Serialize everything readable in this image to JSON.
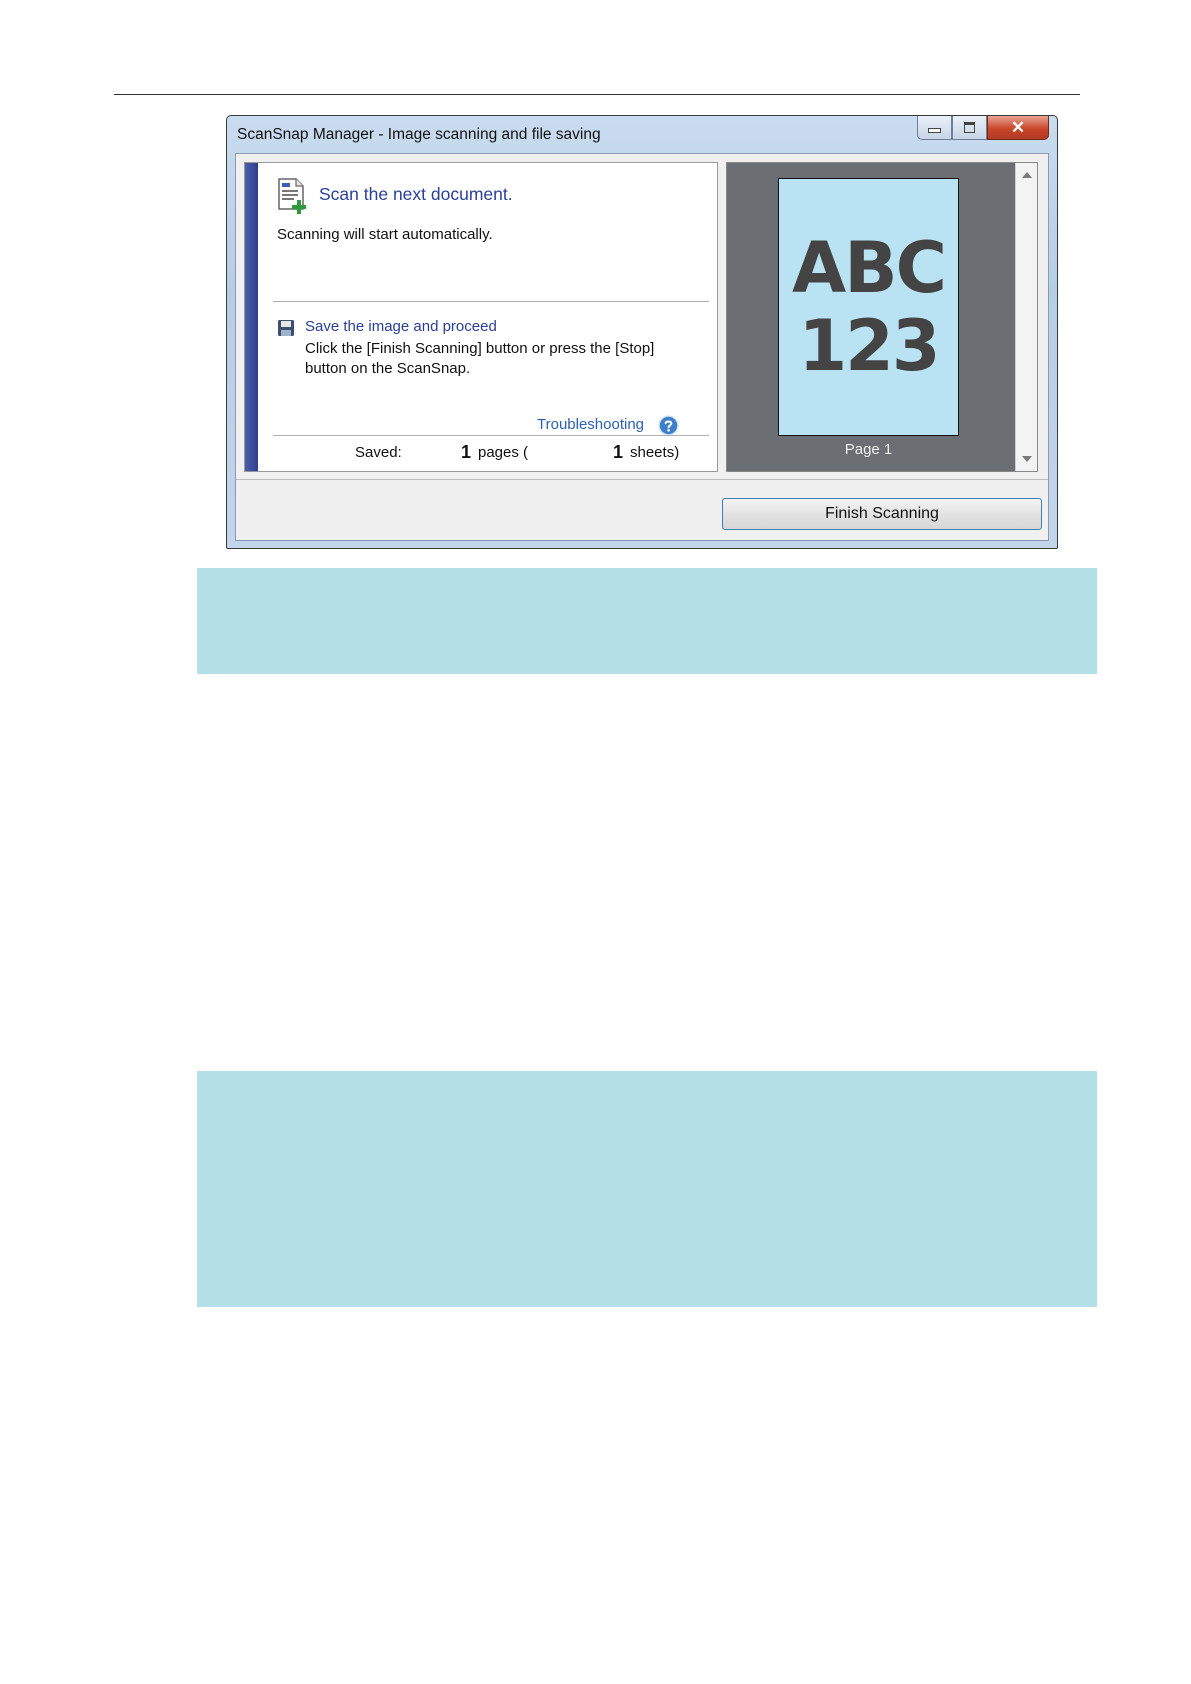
{
  "window": {
    "title": "ScanSnap Manager - Image scanning and file saving",
    "controls": {
      "close_glyph": "✕"
    }
  },
  "scan_panel": {
    "heading": "Scan the next document.",
    "auto_start_text": "Scanning will start automatically.",
    "save_link": "Save the image and proceed",
    "save_description_line1": "Click the [Finish Scanning] button or press the [Stop]",
    "save_description_line2": "button on the ScanSnap.",
    "troubleshooting_link": "Troubleshooting",
    "saved_label": "Saved:",
    "pages_count": "1",
    "pages_text": "pages (",
    "sheets_count": "1",
    "sheets_text": "sheets)"
  },
  "preview": {
    "thumb_line1": "ABC",
    "thumb_line2": "123",
    "page_label": "Page 1"
  },
  "actions": {
    "finish_scanning_label": "Finish Scanning"
  },
  "colors": {
    "accent_band": "#b3e0e6",
    "link_blue": "#2a3f97",
    "preview_bg": "#6b6f73",
    "thumb_bg": "#b9e3f2",
    "close_red": "#c9462c"
  }
}
